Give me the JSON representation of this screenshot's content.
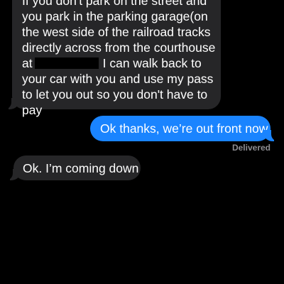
{
  "thread": {
    "messages": [
      {
        "direction": "received",
        "lines": [
          "If you don't park on the street and",
          "you park in the parking garage(on",
          "the west side of the railroad tracks",
          "directly across from the courthouse",
          "I can walk back to",
          "your car with you and use my pass",
          "to let you out so you don't have to",
          "pay"
        ],
        "line5_prefix": "at"
      },
      {
        "direction": "sent",
        "text": "Ok thanks, we’re out front now"
      },
      {
        "direction": "received",
        "text": "Ok. I’m coming down"
      }
    ],
    "delivery_status": "Delivered"
  },
  "colors": {
    "background": "#000000",
    "received_bubble": "#262628",
    "sent_bubble": "#1a84ff",
    "status_text": "#8e8e93"
  }
}
